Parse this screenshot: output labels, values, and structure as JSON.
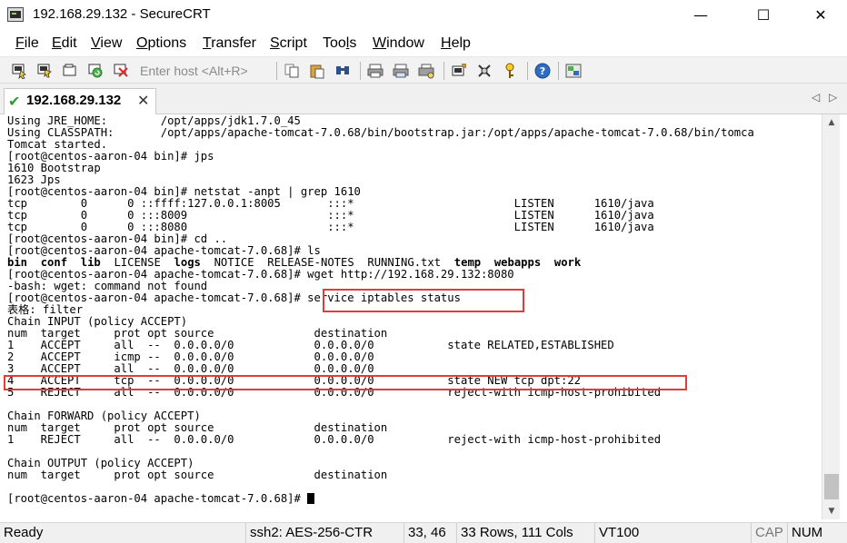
{
  "window": {
    "title": "192.168.29.132 - SecureCRT",
    "minimize_glyph": "—",
    "maximize_glyph": "☐",
    "close_glyph": "✕"
  },
  "menu": {
    "items": [
      {
        "label": "File",
        "mnemonic": "F",
        "rest": "ile"
      },
      {
        "label": "Edit",
        "mnemonic": "E",
        "rest": "dit"
      },
      {
        "label": "View",
        "mnemonic": "V",
        "rest": "iew"
      },
      {
        "label": "Options",
        "mnemonic": "O",
        "rest": "ptions"
      },
      {
        "label": "Transfer",
        "mnemonic": "T",
        "rest": "ransfer"
      },
      {
        "label": "Script",
        "mnemonic": "S",
        "rest": "cript"
      },
      {
        "label": "Tools",
        "mnemonic": "l",
        "pre": "Too",
        "rest": "s"
      },
      {
        "label": "Window",
        "mnemonic": "W",
        "rest": "indow"
      },
      {
        "label": "Help",
        "mnemonic": "H",
        "rest": "elp"
      }
    ]
  },
  "toolbar": {
    "host_placeholder": "Enter host <Alt+R>",
    "icons": [
      "connect-icon",
      "quick-connect-icon",
      "connect-tab-icon",
      "reconnect-icon",
      "disconnect-icon",
      "copy-icon",
      "paste-icon",
      "find-icon",
      "print-icon",
      "print-selection-icon",
      "session-options-icon",
      "global-options-icon",
      "keymap-icon",
      "help-icon",
      "sftp-icon"
    ]
  },
  "tab": {
    "label": "192.168.29.132",
    "status": "connected",
    "close_glyph": "✕",
    "scroll_left_glyph": "◁",
    "scroll_right_glyph": "▷"
  },
  "terminal": {
    "lines": [
      "Using JRE_HOME:        /opt/apps/jdk1.7.0_45",
      "Using CLASSPATH:       /opt/apps/apache-tomcat-7.0.68/bin/bootstrap.jar:/opt/apps/apache-tomcat-7.0.68/bin/tomca",
      "Tomcat started.",
      "[root@centos-aaron-04 bin]# jps",
      "1610 Bootstrap",
      "1623 Jps",
      "[root@centos-aaron-04 bin]# netstat -anpt | grep 1610",
      "tcp        0      0 ::ffff:127.0.0.1:8005       :::*                        LISTEN      1610/java",
      "tcp        0      0 :::8009                     :::*                        LISTEN      1610/java",
      "tcp        0      0 :::8080                     :::*                        LISTEN      1610/java",
      "[root@centos-aaron-04 bin]# cd ..",
      "[root@centos-aaron-04 apache-tomcat-7.0.68]# ls",
      "__LS__",
      "[root@centos-aaron-04 apache-tomcat-7.0.68]# wget http://192.168.29.132:8080",
      "-bash: wget: command not found",
      "[root@centos-aaron-04 apache-tomcat-7.0.68]# service iptables status",
      "表格: filter",
      "Chain INPUT (policy ACCEPT)",
      "num  target     prot opt source               destination",
      "1    ACCEPT     all  --  0.0.0.0/0            0.0.0.0/0           state RELATED,ESTABLISHED",
      "2    ACCEPT     icmp --  0.0.0.0/0            0.0.0.0/0",
      "3    ACCEPT     all  --  0.0.0.0/0            0.0.0.0/0",
      "4    ACCEPT     tcp  --  0.0.0.0/0            0.0.0.0/0           state NEW tcp dpt:22",
      "5    REJECT     all  --  0.0.0.0/0            0.0.0.0/0           reject-with icmp-host-prohibited",
      "",
      "Chain FORWARD (policy ACCEPT)",
      "num  target     prot opt source               destination",
      "1    REJECT     all  --  0.0.0.0/0            0.0.0.0/0           reject-with icmp-host-prohibited",
      "",
      "Chain OUTPUT (policy ACCEPT)",
      "num  target     prot opt source               destination",
      "",
      "[root@centos-aaron-04 apache-tomcat-7.0.68]# "
    ],
    "ls_entries": [
      {
        "name": "bin",
        "bold": true
      },
      {
        "name": "conf",
        "bold": true
      },
      {
        "name": "lib",
        "bold": true
      },
      {
        "name": "LICENSE",
        "bold": false
      },
      {
        "name": "logs",
        "bold": true
      },
      {
        "name": "NOTICE",
        "bold": false
      },
      {
        "name": "RELEASE-NOTES",
        "bold": false
      },
      {
        "name": "RUNNING.txt",
        "bold": false
      },
      {
        "name": "temp",
        "bold": true
      },
      {
        "name": "webapps",
        "bold": true
      },
      {
        "name": "work",
        "bold": true
      }
    ]
  },
  "annotations": {
    "box_color": "#e03c3c"
  },
  "scrollbar": {
    "up_glyph": "▲",
    "down_glyph": "▼"
  },
  "status": {
    "ready": "Ready",
    "encryption": "ssh2: AES-256-CTR",
    "cursor_pos": "33,  46",
    "size": "33 Rows, 111 Cols",
    "terminal_type": "VT100",
    "cap": "CAP",
    "num": "NUM"
  }
}
